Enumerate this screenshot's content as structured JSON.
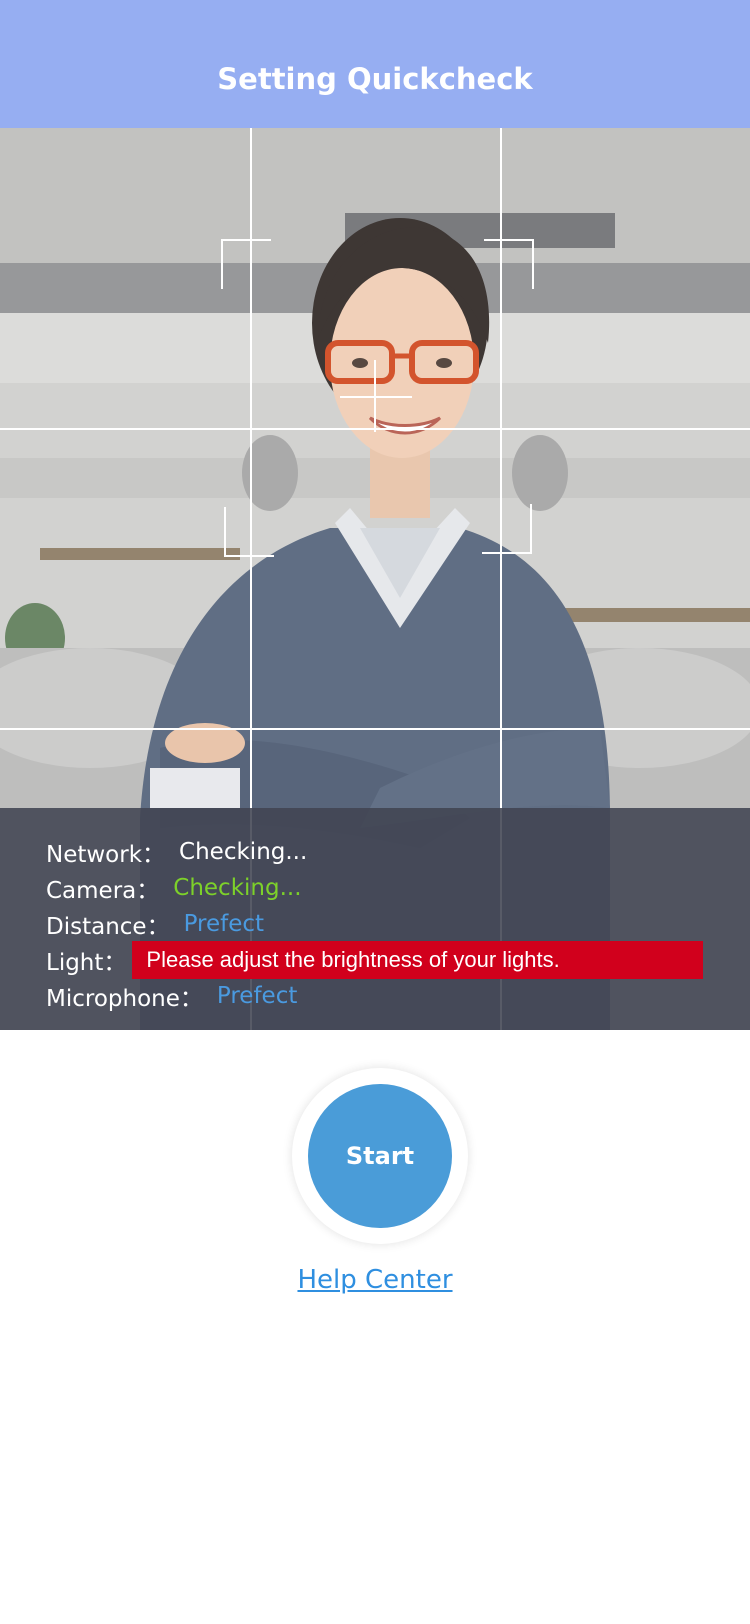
{
  "header": {
    "title": "Setting Quickcheck"
  },
  "status": {
    "network": {
      "label": "Network：",
      "value": "Checking..."
    },
    "camera": {
      "label": "Camera：",
      "value": "Checking..."
    },
    "distance": {
      "label": "Distance：",
      "value": "Prefect"
    },
    "light": {
      "label": "Light：",
      "value": "Please adjust the brightness of your lights."
    },
    "microphone": {
      "label": "Microphone：",
      "value": "Prefect"
    }
  },
  "actions": {
    "start_label": "Start",
    "help_label": "Help Center"
  },
  "colors": {
    "header_bg": "#96aef2",
    "accent_blue": "#4a9cd8",
    "ok_green": "#7dd12a",
    "ok_blue": "#4a9ae0",
    "warning_red": "#d1001c",
    "link_blue": "#2f8fe0"
  }
}
